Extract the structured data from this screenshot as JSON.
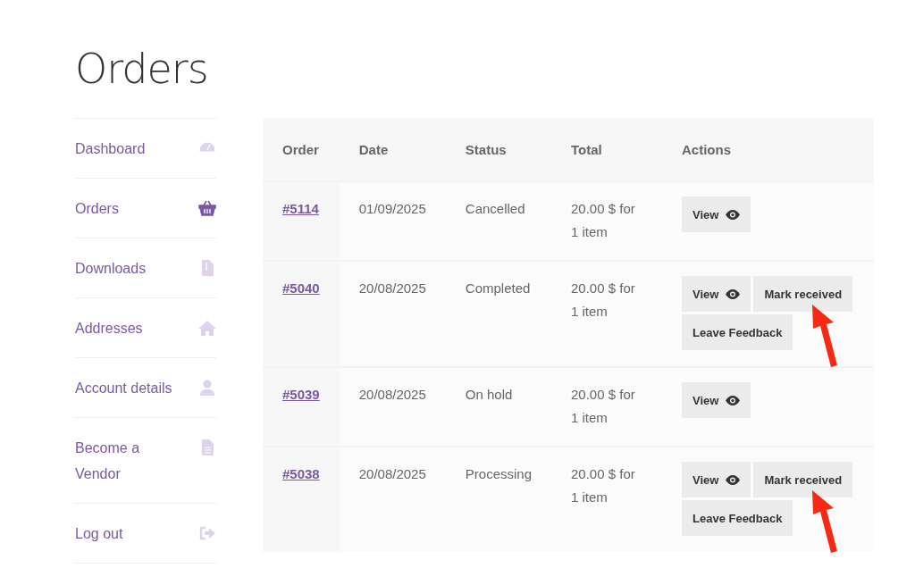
{
  "page_title": "Orders",
  "sidebar": {
    "items": [
      {
        "label": "Dashboard",
        "selected": false
      },
      {
        "label": "Orders",
        "selected": true
      },
      {
        "label": "Downloads",
        "selected": false
      },
      {
        "label": "Addresses",
        "selected": false
      },
      {
        "label": "Account details",
        "selected": false
      },
      {
        "label": "Become a Vendor",
        "selected": false
      },
      {
        "label": "Log out",
        "selected": false
      }
    ]
  },
  "table": {
    "columns": [
      "Order",
      "Date",
      "Status",
      "Total",
      "Actions"
    ],
    "rows": [
      {
        "order": "#5114",
        "date": "01/09/2025",
        "status": "Cancelled",
        "total": "20.00 $ for 1 item",
        "arrow": false,
        "actions": [
          {
            "label": "View",
            "kind": "view"
          }
        ]
      },
      {
        "order": "#5040",
        "date": "20/08/2025",
        "status": "Completed",
        "total": "20.00 $ for 1 item",
        "arrow": true,
        "actions": [
          {
            "label": "View",
            "kind": "view"
          },
          {
            "label": "Mark received",
            "kind": "plain"
          },
          {
            "label": "Leave Feedback",
            "kind": "plain"
          }
        ]
      },
      {
        "order": "#5039",
        "date": "20/08/2025",
        "status": "On hold",
        "total": "20.00 $ for 1 item",
        "arrow": false,
        "actions": [
          {
            "label": "View",
            "kind": "view"
          }
        ]
      },
      {
        "order": "#5038",
        "date": "20/08/2025",
        "status": "Processing",
        "total": "20.00 $ for 1 item",
        "arrow": true,
        "actions": [
          {
            "label": "View",
            "kind": "view"
          },
          {
            "label": "Mark received",
            "kind": "plain"
          },
          {
            "label": "Leave Feedback",
            "kind": "plain"
          }
        ]
      }
    ]
  }
}
